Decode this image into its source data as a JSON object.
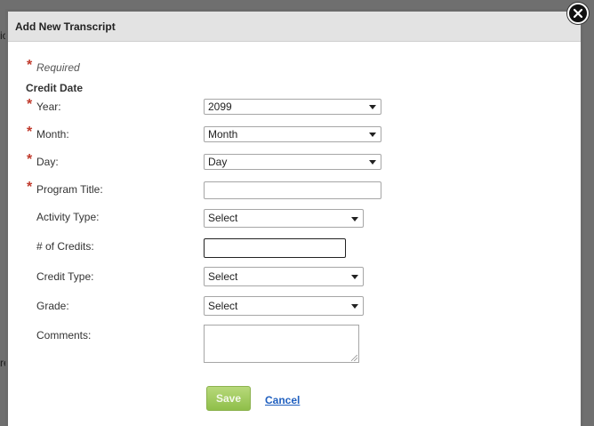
{
  "background": {
    "left_text_top": "ic",
    "left_text_bottom": "re"
  },
  "modal": {
    "title": "Add New Transcript",
    "close_icon": "close-icon"
  },
  "form": {
    "required_note": "Required",
    "section_title": "Credit Date",
    "year": {
      "label": "Year:",
      "value": "2099"
    },
    "month": {
      "label": "Month:",
      "value": "Month"
    },
    "day": {
      "label": "Day:",
      "value": "Day"
    },
    "program_title": {
      "label": "Program Title:",
      "value": ""
    },
    "activity_type": {
      "label": "Activity Type:",
      "value": "Select"
    },
    "credits": {
      "label": "# of Credits:",
      "value": ""
    },
    "credit_type": {
      "label": "Credit Type:",
      "value": "Select"
    },
    "grade": {
      "label": "Grade:",
      "value": "Select"
    },
    "comments": {
      "label": "Comments:",
      "value": ""
    }
  },
  "actions": {
    "save_label": "Save",
    "cancel_label": "Cancel"
  },
  "colors": {
    "required_star": "#c0392b",
    "save_button": "#9cc85a",
    "cancel_link": "#1f5fbf"
  }
}
